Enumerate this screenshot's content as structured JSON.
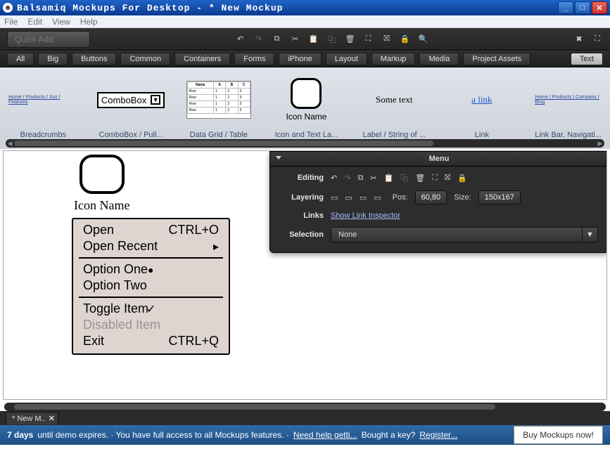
{
  "window": {
    "title": "Balsamiq Mockups For Desktop - * New Mockup"
  },
  "menubar": [
    "File",
    "Edit",
    "View",
    "Help"
  ],
  "toolbar": {
    "quick_add_placeholder": "Quick Add"
  },
  "categories": [
    "All",
    "Big",
    "Buttons",
    "Common",
    "Containers",
    "Forms",
    "iPhone",
    "Layout",
    "Markup",
    "Media",
    "Project Assets",
    "Text"
  ],
  "active_category": "Text",
  "gallery": {
    "breadcrumbs_caption": "Breadcrumbs",
    "breadcrumbs_text": "Home / Products / Xyz / Features",
    "combobox_caption": "ComboBox / Pull...",
    "combobox_text": "ComboBox",
    "datagrid_caption": "Data Grid / Table",
    "iconlabel_caption": "Icon and Text La...",
    "iconlabel_text": "Icon Name",
    "label_caption": "Label / String of ...",
    "label_text": "Some text",
    "link_caption": "Link",
    "link_text": "a link",
    "linkbar_caption": "Link Bar, Navigati...",
    "linkbar_text": "Home | Products | Company | Blog"
  },
  "canvas": {
    "icon_label": "Icon Name",
    "menu": {
      "open": "Open",
      "open_sc": "CTRL+O",
      "open_recent": "Open Recent",
      "opt1": "Option One",
      "opt2": "Option Two",
      "toggle": "Toggle Item",
      "disabled": "Disabled Item",
      "exit": "Exit",
      "exit_sc": "CTRL+Q"
    }
  },
  "prop": {
    "title": "Menu",
    "editing_label": "Editing",
    "layering_label": "Layering",
    "pos_label": "Pos:",
    "pos_value": "60,80",
    "size_label": "Size:",
    "size_value": "150x167",
    "links_label": "Links",
    "links_value": "Show Link Inspector",
    "selection_label": "Selection",
    "selection_value": "None"
  },
  "footer_tab": "* New M..",
  "status": {
    "days": "7 days",
    "rest1": " until demo expires. · You have full access to all Mockups features. · ",
    "need_help": "Need help getti...",
    "rest2": " Bought a key? ",
    "register": "Register...",
    "buy": "Buy Mockups now!"
  }
}
